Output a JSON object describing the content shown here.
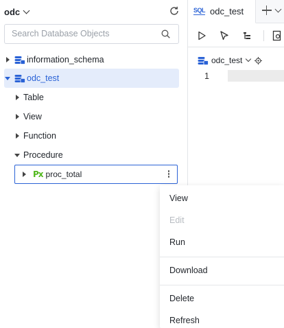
{
  "sidebar": {
    "connection": "odc",
    "search_placeholder": "Search Database Objects",
    "tree": {
      "db1": "information_schema",
      "db2": "odc_test",
      "folders": [
        "Table",
        "View",
        "Function",
        "Procedure"
      ],
      "procedure": {
        "icon_text": "Px",
        "name": "proc_total"
      }
    }
  },
  "editor": {
    "tab_icon": "SQL",
    "tab_label": "odc_test",
    "db_context": "odc_test",
    "line_number": "1"
  },
  "context_menu": {
    "items": [
      "View",
      "Edit",
      "Run",
      "Download",
      "Delete",
      "Refresh"
    ],
    "disabled": [
      "Edit"
    ]
  },
  "colors": {
    "accent": "#2a62d6",
    "selected_bg": "#e4ecfb",
    "proc_icon": "#52b81e"
  },
  "icons": [
    "refresh-icon",
    "search-icon",
    "database-icon",
    "play-icon",
    "pointer-icon",
    "format-icon",
    "document-icon",
    "plus-icon",
    "target-icon",
    "more-icon"
  ]
}
